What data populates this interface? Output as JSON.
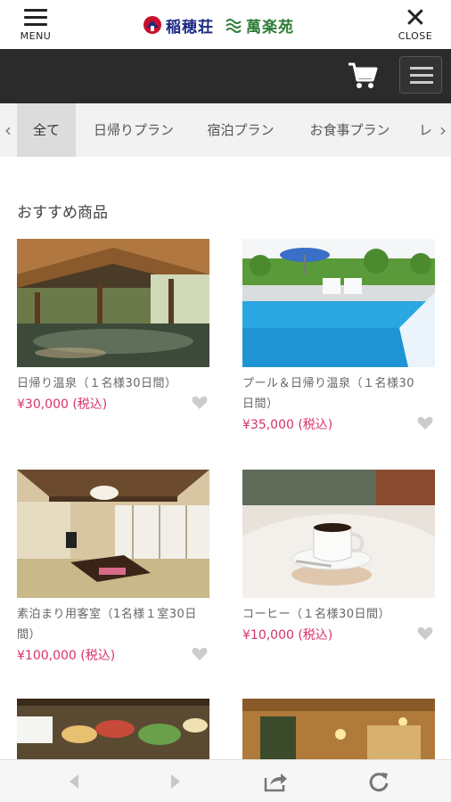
{
  "header": {
    "menu_label": "MENU",
    "close_label": "CLOSE",
    "logo_text_1": "稲穂荘",
    "logo_text_2": "萬楽苑"
  },
  "tabs": {
    "items": [
      "全て",
      "日帰りプラン",
      "宿泊プラン",
      "お食事プラン",
      "レ"
    ],
    "active_index": 0
  },
  "section": {
    "title": "おすすめ商品"
  },
  "products": [
    {
      "name_line1": "日帰り温泉（１名様30日間）",
      "name_line2": "",
      "price": "¥30,000 (税込)",
      "image": "hot-spring-photo"
    },
    {
      "name_line1": "プール＆日帰り温泉（１名様30",
      "name_line2": "日間）",
      "price": "¥35,000 (税込)",
      "image": "pool-photo"
    },
    {
      "name_line1": "素泊まり用客室（1名様１室30日",
      "name_line2": "間）",
      "price": "¥100,000 (税込)",
      "image": "guest-room-photo"
    },
    {
      "name_line1": "コーヒー（１名様30日間）",
      "name_line2": "",
      "price": "¥10,000 (税込)",
      "image": "coffee-photo"
    },
    {
      "name_line1": "",
      "name_line2": "",
      "price": "",
      "image": "food-photo"
    },
    {
      "name_line1": "",
      "name_line2": "",
      "price": "",
      "image": "interior-photo"
    }
  ],
  "colors": {
    "price": "#d6336c",
    "darkbar": "#2b2b2b",
    "tab_bg": "#f2f2f2",
    "tab_active": "#dcdcdc"
  },
  "icons": {
    "cart": "shopping-cart-icon",
    "hamburger": "hamburger-icon",
    "heart": "heart-icon",
    "back": "back-arrow-icon",
    "forward": "forward-arrow-icon",
    "share": "share-icon",
    "reload": "reload-icon"
  }
}
